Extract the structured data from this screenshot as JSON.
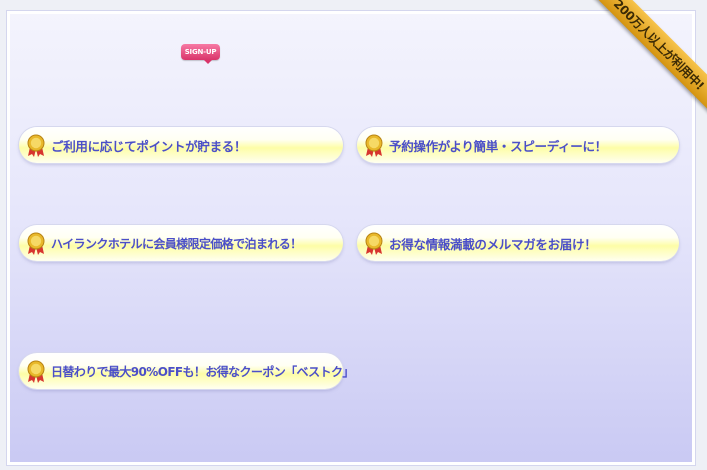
{
  "signup_badge": "SIGN-UP",
  "ribbon": "200万人以上が利用中!",
  "features": [
    {
      "label": "ご利用に応じてポイントが貯まる！",
      "icon": "medal-icon"
    },
    {
      "label": "予約操作がより簡単・スピーディーに！",
      "icon": "medal-icon"
    },
    {
      "label": "ハイランクホテルに会員様限定価格で泊まれる！",
      "icon": "medal-icon"
    },
    {
      "label": "お得な情報満載のメルマガをお届け！",
      "icon": "medal-icon"
    },
    {
      "label": "日替わりで最大90%OFFも！お得なクーポン「ベストク」",
      "icon": "medal-icon"
    }
  ],
  "colors": {
    "label_text": "#4b4fc8",
    "pill_yellow": "#fdfda6",
    "ribbon_gold": "#e2a520",
    "signup_pink": "#e8477d"
  }
}
